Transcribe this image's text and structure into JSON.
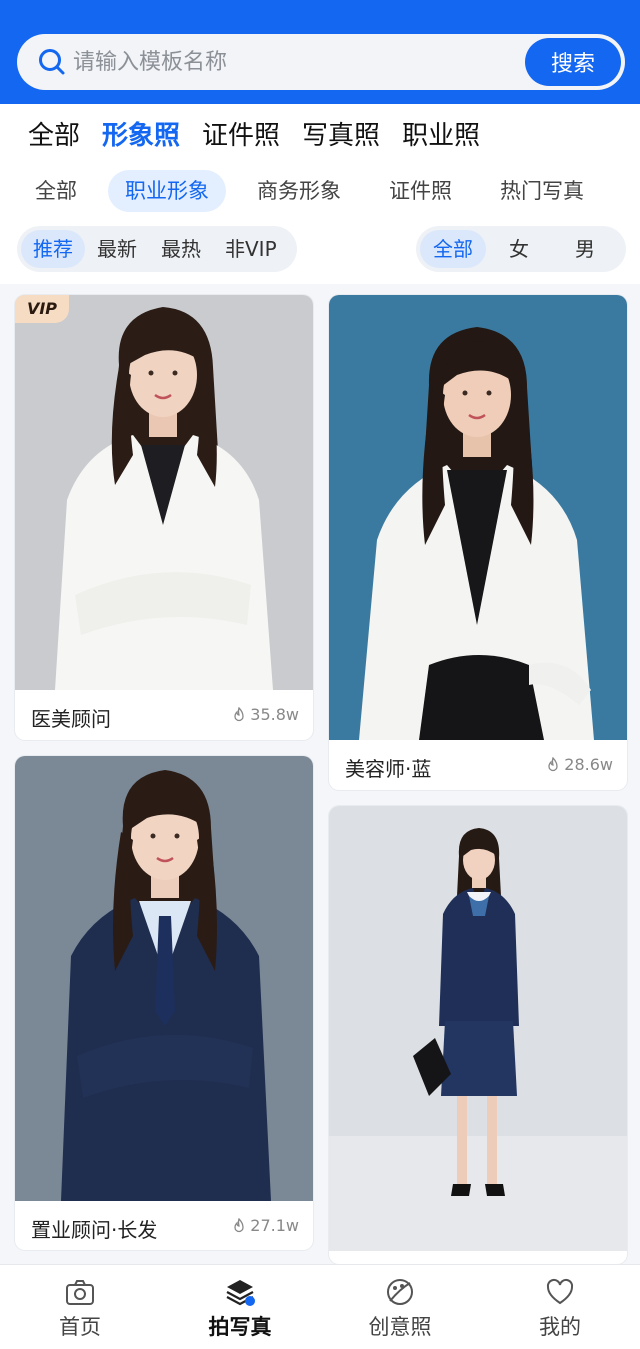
{
  "search": {
    "placeholder": "请输入模板名称",
    "button_label": "搜索"
  },
  "categories": [
    {
      "label": "全部",
      "active": false
    },
    {
      "label": "形象照",
      "active": true
    },
    {
      "label": "证件照",
      "active": false
    },
    {
      "label": "写真照",
      "active": false
    },
    {
      "label": "职业照",
      "active": false
    }
  ],
  "subcategories": [
    {
      "label": "全部",
      "active": false
    },
    {
      "label": "职业形象",
      "active": true
    },
    {
      "label": "商务形象",
      "active": false
    },
    {
      "label": "证件照",
      "active": false
    },
    {
      "label": "热门写真",
      "active": false
    }
  ],
  "sort_options": [
    {
      "label": "推荐",
      "active": true
    },
    {
      "label": "最新",
      "active": false
    },
    {
      "label": "最热",
      "active": false
    },
    {
      "label": "非VIP",
      "active": false
    }
  ],
  "gender_options": [
    {
      "label": "全部",
      "active": true
    },
    {
      "label": "女",
      "active": false
    },
    {
      "label": "男",
      "active": false
    }
  ],
  "cards": [
    {
      "title": "医美顾问",
      "count": "35.8w",
      "vip": true,
      "vip_label": "VIP",
      "background": "#c9cbce",
      "outfit": "white-blazer"
    },
    {
      "title": "美容师·蓝",
      "count": "28.6w",
      "vip": false,
      "background": "#3b7aa0",
      "outfit": "white-coat"
    },
    {
      "title": "置业顾问·长发",
      "count": "27.1w",
      "vip": false,
      "background": "#7b8896",
      "outfit": "navy-suit"
    },
    {
      "title": "",
      "count": "",
      "vip": false,
      "background": "#dcdfe3",
      "outfit": "navy-skirt-suit"
    }
  ],
  "bottom_nav": [
    {
      "label": "首页",
      "icon": "camera-icon",
      "active": false
    },
    {
      "label": "拍写真",
      "icon": "layers-icon",
      "active": true
    },
    {
      "label": "创意照",
      "icon": "palette-icon",
      "active": false
    },
    {
      "label": "我的",
      "icon": "heart-icon",
      "active": false
    }
  ],
  "colors": {
    "primary": "#1467f0",
    "vip_badge": "#f7dcc4"
  }
}
